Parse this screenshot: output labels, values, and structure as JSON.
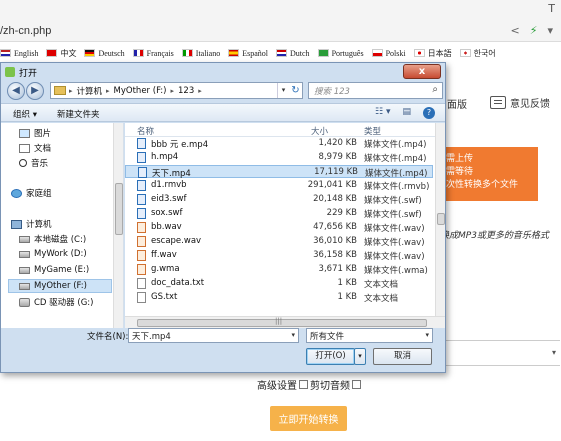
{
  "browser": {
    "url": "/zh-cn.php",
    "top_icon": "T",
    "address_icons": [
      "share-icon",
      "bolt-icon",
      "chevron-down-icon"
    ]
  },
  "languages": [
    {
      "label": "English",
      "flag": "en"
    },
    {
      "label": "中文",
      "flag": "cn"
    },
    {
      "label": "Deutsch",
      "flag": "de"
    },
    {
      "label": "Français",
      "flag": "fr"
    },
    {
      "label": "Italiano",
      "flag": "it"
    },
    {
      "label": "Español",
      "flag": "es"
    },
    {
      "label": "Dutch",
      "flag": "nl"
    },
    {
      "label": "Português",
      "flag": "pt"
    },
    {
      "label": "Polski",
      "flag": "pl"
    },
    {
      "label": "日本語",
      "flag": "jp"
    },
    {
      "label": "한국어",
      "flag": "kr"
    }
  ],
  "page": {
    "version_link": "面版",
    "feedback_link": "意见反馈",
    "upload_lines": [
      "需上传",
      "需等待",
      "次性转换多个文件"
    ],
    "note": "换成MP3或更多的音乐格式",
    "advanced_label": "高级设置",
    "cut_audio_label": "剪切音频",
    "convert_button": "立即开始转换",
    "accent_color": "#f07a30",
    "convert_color": "#f6b24a"
  },
  "dialog": {
    "title": "打开",
    "close_label": "x",
    "path": [
      "计算机",
      "MyOther (F:)",
      "123"
    ],
    "search_placeholder": "搜索 123",
    "organize_label": "组织 ▾",
    "new_folder_label": "新建文件夹",
    "nav_items": [
      {
        "label": "图片",
        "icon": "pictures-icon"
      },
      {
        "label": "文档",
        "icon": "documents-icon"
      },
      {
        "label": "音乐",
        "icon": "music-icon"
      },
      {
        "label": "家庭组",
        "icon": "homegroup-icon"
      },
      {
        "label": "计算机",
        "icon": "computer-icon"
      },
      {
        "label": "本地磁盘 (C:)",
        "icon": "drive-icon"
      },
      {
        "label": "MyWork (D:)",
        "icon": "drive-icon"
      },
      {
        "label": "MyGame (E:)",
        "icon": "drive-icon"
      },
      {
        "label": "MyOther (F:)",
        "icon": "drive-icon",
        "selected": true
      },
      {
        "label": "CD 驱动器 (G:)",
        "icon": "cd-drive-icon"
      }
    ],
    "columns": {
      "name": "名称",
      "size": "大小",
      "type": "类型"
    },
    "files": [
      {
        "name": "bbb 元 e.mp4",
        "size": "1,420 KB",
        "type": "媒体文件(.mp4)",
        "kind": "media"
      },
      {
        "name": "h.mp4",
        "size": "8,979 KB",
        "type": "媒体文件(.mp4)",
        "kind": "media"
      },
      {
        "name": "天下.mp4",
        "size": "17,119 KB",
        "type": "媒体文件(.mp4)",
        "kind": "media",
        "selected": true
      },
      {
        "name": "d1.rmvb",
        "size": "291,041 KB",
        "type": "媒体文件(.rmvb)",
        "kind": "media"
      },
      {
        "name": "eid3.swf",
        "size": "20,148 KB",
        "type": "媒体文件(.swf)",
        "kind": "media"
      },
      {
        "name": "sox.swf",
        "size": "229 KB",
        "type": "媒体文件(.swf)",
        "kind": "media"
      },
      {
        "name": "bb.wav",
        "size": "47,656 KB",
        "type": "媒体文件(.wav)",
        "kind": "audio"
      },
      {
        "name": "escape.wav",
        "size": "36,010 KB",
        "type": "媒体文件(.wav)",
        "kind": "audio"
      },
      {
        "name": "ff.wav",
        "size": "36,158 KB",
        "type": "媒体文件(.wav)",
        "kind": "audio"
      },
      {
        "name": "g.wma",
        "size": "3,671 KB",
        "type": "媒体文件(.wma)",
        "kind": "audio"
      },
      {
        "name": "doc_data.txt",
        "size": "1 KB",
        "type": "文本文档",
        "kind": "text"
      },
      {
        "name": "GS.txt",
        "size": "1 KB",
        "type": "文本文档",
        "kind": "text"
      }
    ],
    "filename_label": "文件名(N):",
    "filename_value": "天下.mp4",
    "filetype_value": "所有文件",
    "open_button": "打开(O)",
    "cancel_button": "取消"
  }
}
